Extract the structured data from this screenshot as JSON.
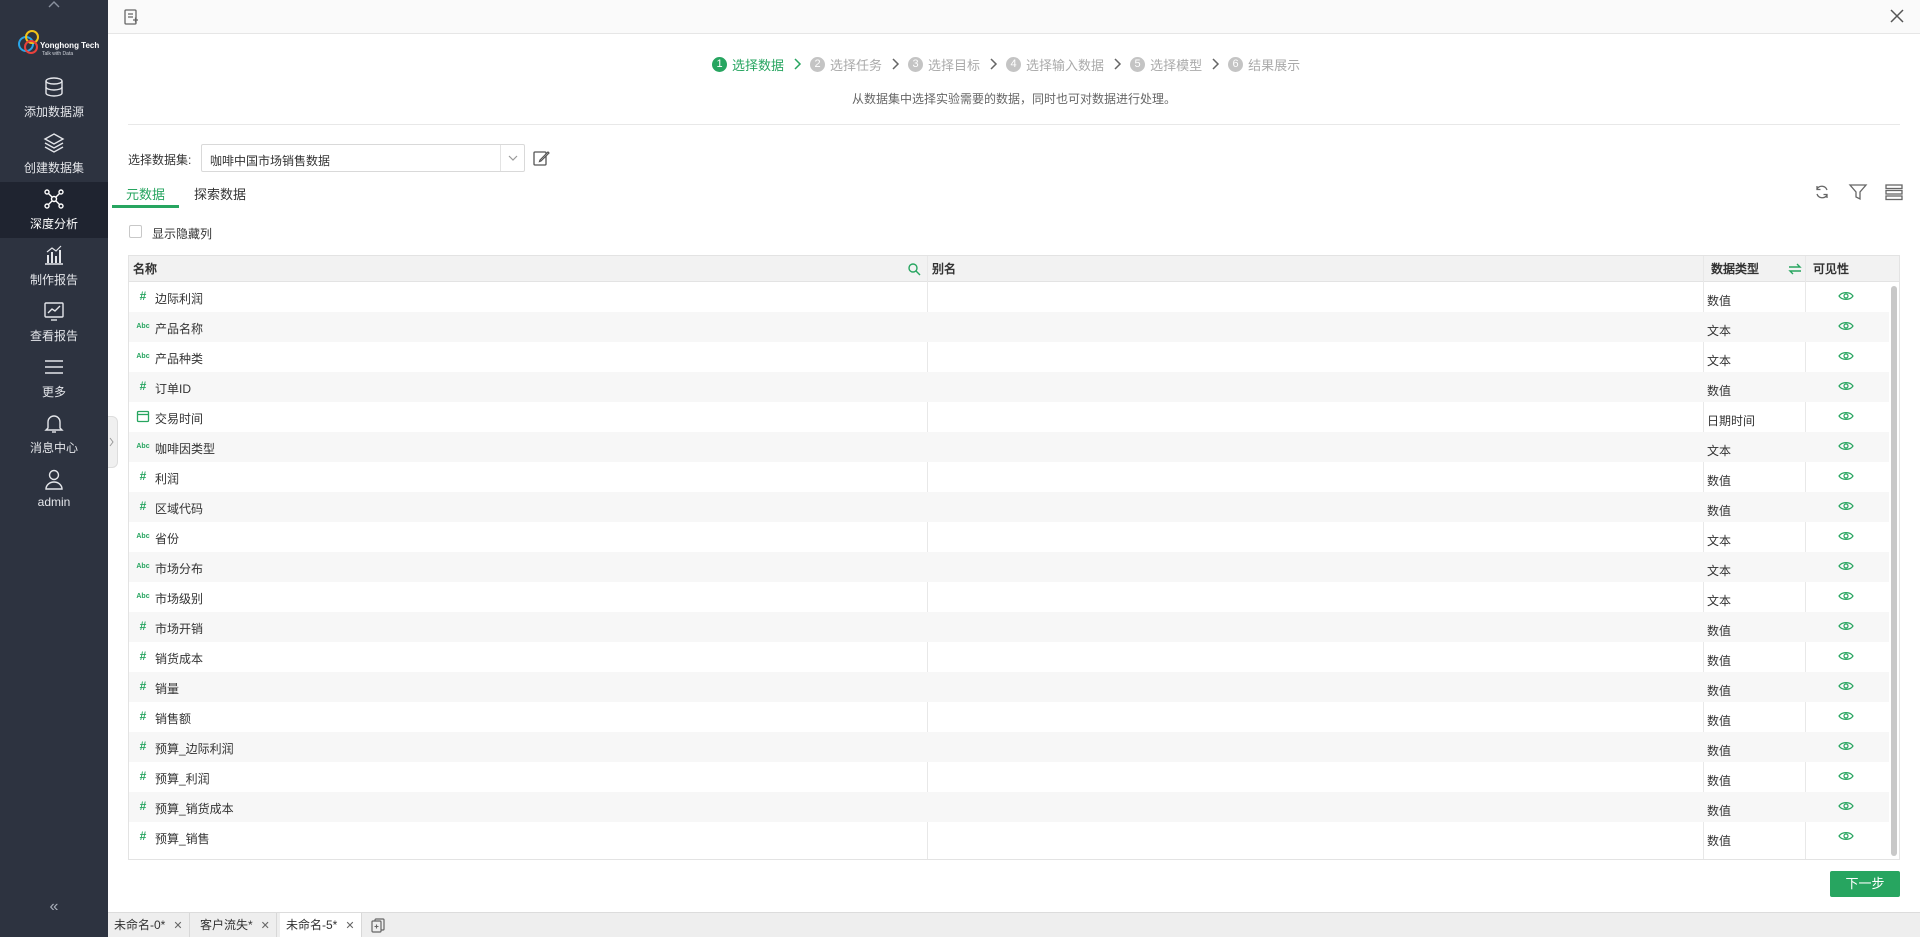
{
  "sidebar": {
    "logo": {
      "name": "Yonghong Tech",
      "tagline": "Talk with Data"
    },
    "items": [
      {
        "label": "添加数据源",
        "icon": "database-icon"
      },
      {
        "label": "创建数据集",
        "icon": "layers-icon"
      },
      {
        "label": "深度分析",
        "icon": "network-icon"
      },
      {
        "label": "制作报告",
        "icon": "bar-chart-icon"
      },
      {
        "label": "查看报告",
        "icon": "line-chart-icon"
      },
      {
        "label": "更多",
        "icon": "menu-icon"
      },
      {
        "label": "消息中心",
        "icon": "bell-icon"
      },
      {
        "label": "admin",
        "icon": "user-icon"
      }
    ],
    "active_index": 2,
    "collapse_glyph": "«"
  },
  "steps": {
    "items": [
      {
        "num": "1",
        "label": "选择数据"
      },
      {
        "num": "2",
        "label": "选择任务"
      },
      {
        "num": "3",
        "label": "选择目标"
      },
      {
        "num": "4",
        "label": "选择输入数据"
      },
      {
        "num": "5",
        "label": "选择模型"
      },
      {
        "num": "6",
        "label": "结果展示"
      }
    ],
    "active_index": 0,
    "description": "从数据集中选择实验需要的数据，同时也可对数据进行处理。"
  },
  "dataset": {
    "label": "选择数据集:",
    "value": "咖啡中国市场销售数据"
  },
  "tabs": [
    {
      "label": "元数据"
    },
    {
      "label": "探索数据"
    }
  ],
  "show_hidden_label": "显示隐藏列",
  "table": {
    "headers": {
      "name": "名称",
      "alias": "别名",
      "type": "数据类型",
      "visibility": "可见性"
    },
    "rows": [
      {
        "kind": "number",
        "name": "边际利润",
        "type": "数值"
      },
      {
        "kind": "text",
        "name": "产品名称",
        "type": "文本"
      },
      {
        "kind": "text",
        "name": "产品种类",
        "type": "文本"
      },
      {
        "kind": "number",
        "name": "订单ID",
        "type": "数值"
      },
      {
        "kind": "date",
        "name": "交易时间",
        "type": "日期时间"
      },
      {
        "kind": "text",
        "name": "咖啡因类型",
        "type": "文本"
      },
      {
        "kind": "number",
        "name": "利润",
        "type": "数值"
      },
      {
        "kind": "number",
        "name": "区域代码",
        "type": "数值"
      },
      {
        "kind": "text",
        "name": "省份",
        "type": "文本"
      },
      {
        "kind": "text",
        "name": "市场分布",
        "type": "文本"
      },
      {
        "kind": "text",
        "name": "市场级别",
        "type": "文本"
      },
      {
        "kind": "number",
        "name": "市场开销",
        "type": "数值"
      },
      {
        "kind": "number",
        "name": "销货成本",
        "type": "数值"
      },
      {
        "kind": "number",
        "name": "销量",
        "type": "数值"
      },
      {
        "kind": "number",
        "name": "销售额",
        "type": "数值"
      },
      {
        "kind": "number",
        "name": "预算_边际利润",
        "type": "数值"
      },
      {
        "kind": "number",
        "name": "预算_利润",
        "type": "数值"
      },
      {
        "kind": "number",
        "name": "预算_销货成本",
        "type": "数值"
      },
      {
        "kind": "number",
        "name": "预算_销售",
        "type": "数值"
      }
    ]
  },
  "type_glyphs": {
    "number": "#",
    "text": "Abc"
  },
  "next_button": "下一步",
  "bottom_tabs": [
    {
      "label": "未命名-0*"
    },
    {
      "label": "客户流失*"
    },
    {
      "label": "未命名-5*"
    }
  ],
  "bottom_active_index": 2,
  "colors": {
    "accent": "#27a560",
    "sidebar_bg": "#2d3340",
    "sidebar_active": "#1f2430"
  }
}
